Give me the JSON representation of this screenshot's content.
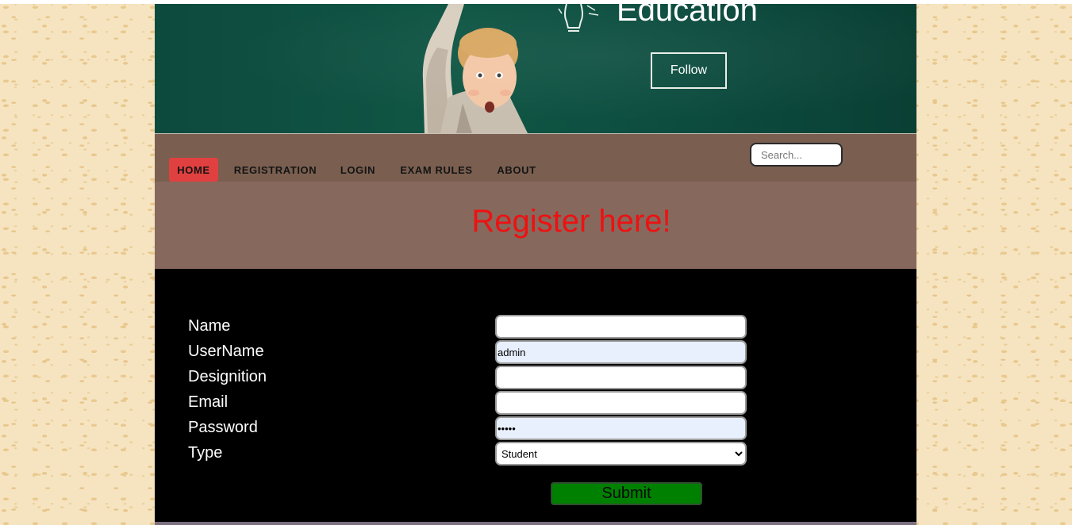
{
  "banner": {
    "title": "Education",
    "follow_label": "Follow"
  },
  "nav": {
    "items": [
      {
        "label": "HOME",
        "active": true
      },
      {
        "label": "REGISTRATION",
        "active": false
      },
      {
        "label": "LOGIN",
        "active": false
      },
      {
        "label": "EXAM RULES",
        "active": false
      },
      {
        "label": "ABOUT",
        "active": false
      }
    ],
    "search_placeholder": "Search..."
  },
  "page": {
    "heading": "Register here!"
  },
  "form": {
    "fields": [
      {
        "label": "Name",
        "value": ""
      },
      {
        "label": "UserName",
        "value": "admin"
      },
      {
        "label": "Designition",
        "value": ""
      },
      {
        "label": "Email",
        "value": ""
      },
      {
        "label": "Password",
        "value": "admin"
      }
    ],
    "type_label": "Type",
    "type_selected": "Student",
    "submit_label": "Submit"
  },
  "colors": {
    "active_nav": "#e0403f",
    "heading": "#ee1111",
    "submit_bg": "#008000",
    "nav_bg": "#7a5f50",
    "band_bg": "#87685d",
    "banner_bg": "#0d4a3e",
    "autofill_bg": "#e8f0fe"
  }
}
